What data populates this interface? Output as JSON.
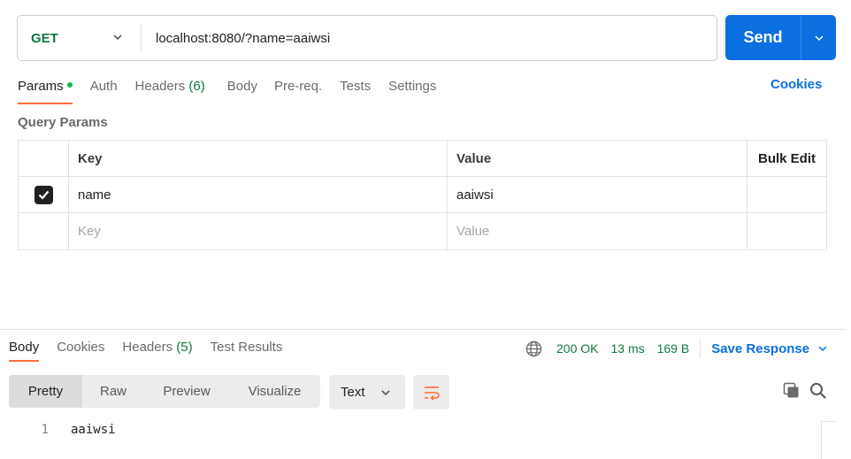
{
  "request": {
    "method": "GET",
    "url": "localhost:8080/?name=aaiwsi",
    "send_label": "Send"
  },
  "request_tabs": [
    {
      "label": "Params"
    },
    {
      "label": "Auth"
    },
    {
      "label": "Headers",
      "count": "(6)"
    },
    {
      "label": "Body"
    },
    {
      "label": "Pre-req."
    },
    {
      "label": "Tests"
    },
    {
      "label": "Settings"
    }
  ],
  "cookies_label": "Cookies",
  "query_params": {
    "title": "Query Params",
    "headers": {
      "key": "Key",
      "value": "Value",
      "bulk_edit": "Bulk Edit"
    },
    "rows": [
      {
        "key": "name",
        "value": "aaiwsi",
        "checked": true
      }
    ],
    "placeholder": {
      "key": "Key",
      "value": "Value"
    }
  },
  "response_tabs": [
    {
      "label": "Body"
    },
    {
      "label": "Cookies"
    },
    {
      "label": "Headers",
      "count": "(5)"
    },
    {
      "label": "Test Results"
    }
  ],
  "response_status": {
    "status": "200 OK",
    "time": "13 ms",
    "size": "169 B",
    "save_label": "Save Response"
  },
  "body_format": {
    "modes": [
      "Pretty",
      "Raw",
      "Preview",
      "Visualize"
    ],
    "selected_type": "Text"
  },
  "response_body": [
    {
      "line": "1",
      "text": "aaiwsi"
    }
  ],
  "colors": {
    "accent": "#0b6fe0",
    "active_tab": "#ff6c37",
    "success": "#0f7a3e"
  }
}
